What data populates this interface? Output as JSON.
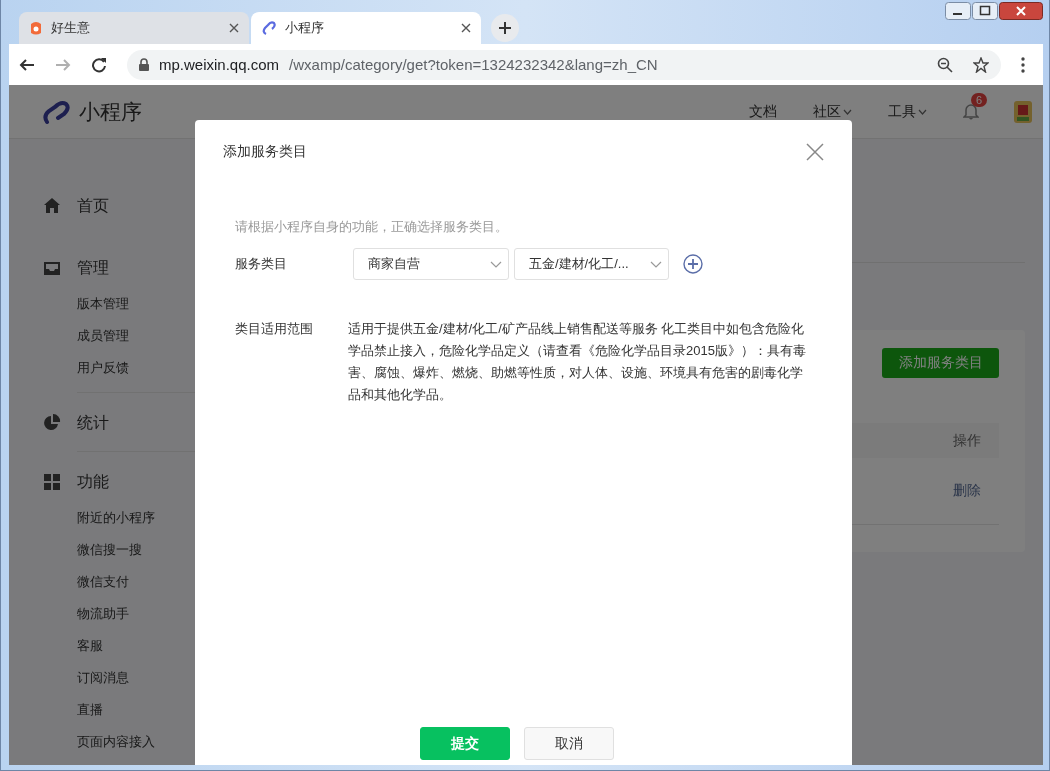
{
  "browser": {
    "tabs": [
      {
        "title": "好生意",
        "selected": false
      },
      {
        "title": "小程序",
        "selected": true
      }
    ],
    "nav_buttons": [
      {
        "kind": "back",
        "disabled": false
      },
      {
        "kind": "forward",
        "disabled": true
      },
      {
        "kind": "reload",
        "disabled": false
      }
    ],
    "address": {
      "host": "mp.weixin.qq.com",
      "path": "/wxamp/category/get?token=1324232342&lang=zh_CN"
    }
  },
  "header": {
    "logo": "小程序",
    "nav": [
      {
        "label": "文档",
        "dropdown": false
      },
      {
        "label": "社区",
        "dropdown": true
      },
      {
        "label": "工具",
        "dropdown": true
      }
    ],
    "notifications": "6"
  },
  "sidebar": {
    "sections": [
      {
        "kind": "home",
        "title": "首页"
      },
      {
        "kind": "inbox",
        "title": "管理",
        "children": [
          "版本管理",
          "成员管理",
          "用户反馈"
        ]
      },
      {
        "kind": "pie",
        "title": "统计"
      },
      {
        "kind": "grid",
        "title": "功能",
        "children": [
          "附近的小程序",
          "微信搜一搜",
          "微信支付",
          "物流助手",
          "客服",
          "订阅消息",
          "直播",
          "页面内容接入"
        ]
      }
    ]
  },
  "main": {
    "add_button": "添加服务类目",
    "table": {
      "columns": [
        "操作"
      ],
      "rows": [
        [
          "删除"
        ]
      ]
    }
  },
  "dialog": {
    "title": "添加服务类目",
    "hint": "请根据小程序自身的功能，正确选择服务类目。",
    "category": {
      "label": "服务类目",
      "selects": [
        "商家自营",
        "五金/建材/化工/..."
      ]
    },
    "scope": {
      "label": "类目适用范围",
      "text": "适用于提供五金/建材/化工/矿产品线上销售配送等服务 化工类目中如包含危险化学品禁止接入，危险化学品定义（请查看《危险化学品目录2015版》）：具有毒害、腐蚀、爆炸、燃烧、助燃等性质，对人体、设施、环境具有危害的剧毒化学品和其他化学品。"
    },
    "buttons": [
      {
        "label": "提交",
        "primary": true
      },
      {
        "label": "取消",
        "primary": false
      }
    ]
  }
}
